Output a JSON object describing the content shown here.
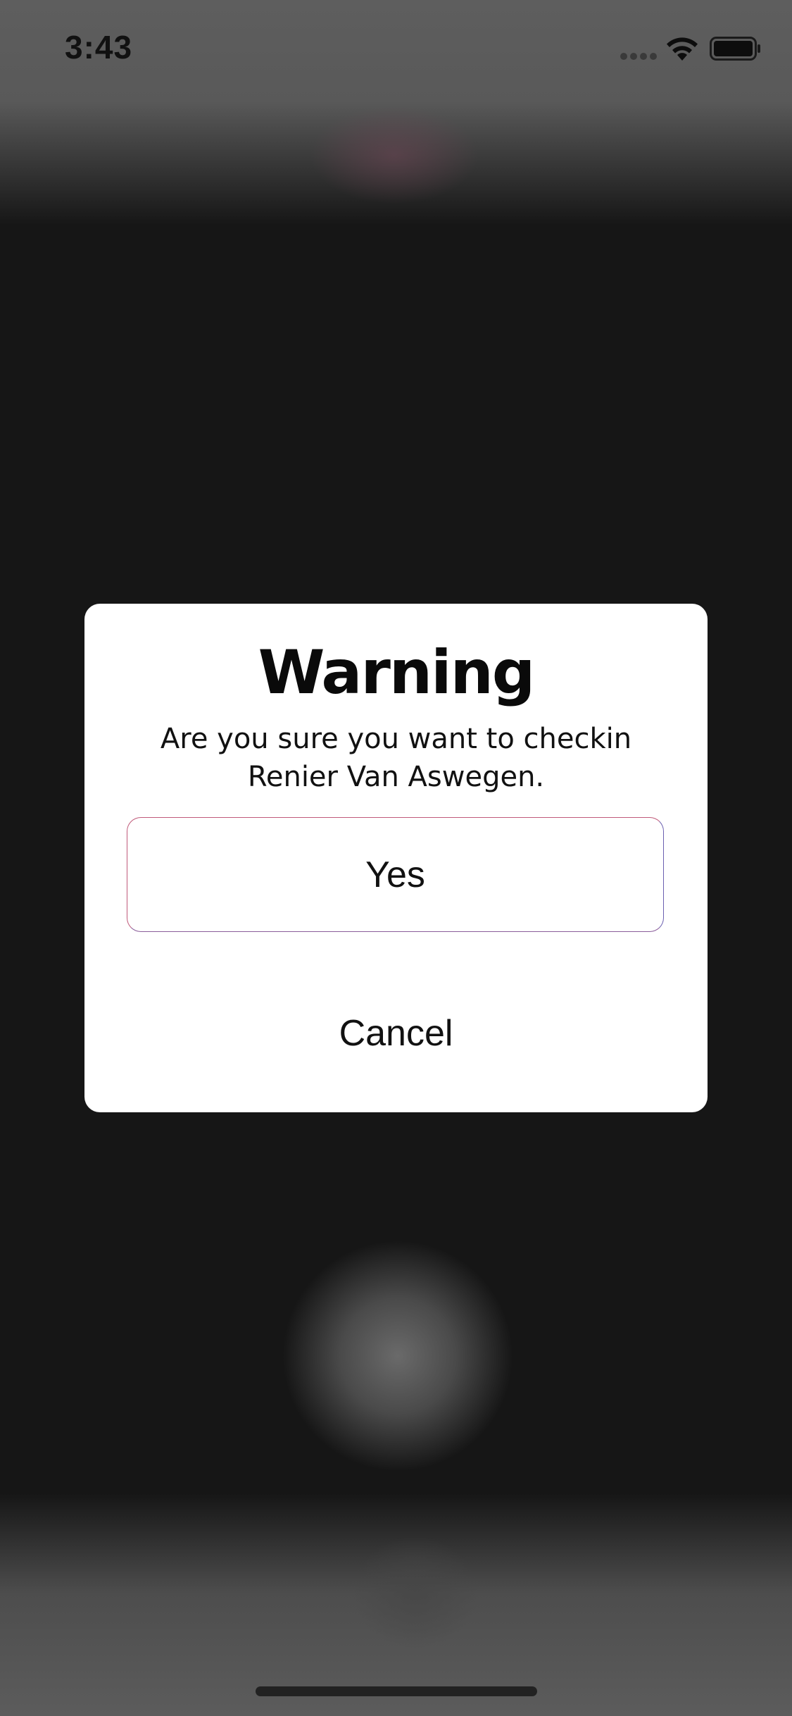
{
  "status_bar": {
    "time": "3:43",
    "signal_icon": "cellular-signal-icon",
    "wifi_icon": "wifi-icon",
    "battery_icon": "battery-icon"
  },
  "dialog": {
    "title": "Warning",
    "message": "Are you sure you want to checkin Renier Van Aswegen.",
    "confirm_label": "Yes",
    "cancel_label": "Cancel"
  },
  "colors": {
    "dialog_background": "#ffffff",
    "overlay": "#161616",
    "button_border_start": "#c05a7a",
    "button_border_end": "#6a5fb0"
  }
}
